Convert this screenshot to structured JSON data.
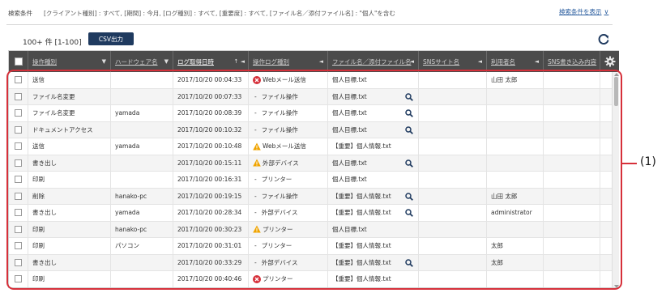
{
  "filter": {
    "label": "検索条件",
    "text": "[クライアント種別] : すべて, [期間] : 今月, [ログ種別] : すべて, [重要度] : すべて, [ファイル名／添付ファイル名] : \"個人\"を含む",
    "toggle_label": "検索条件を表示"
  },
  "results": {
    "count": "100+ 件 [1-100]",
    "csv_label": "CSV出力"
  },
  "columns": [
    "操作種別",
    "ハードウェア名",
    "ログ取得日時",
    "操作ログ種別",
    "ファイル名／添付ファイル名",
    "SNSサイト名",
    "利用者名",
    "SNS書き込み内容"
  ],
  "rows": [
    {
      "op": "送信",
      "hw": "",
      "dt": "2017/10/20 00:04:33",
      "icon": "error",
      "log": "Webメール送信",
      "file": "個人目標.txt",
      "mag": false,
      "user": "山田 太郎"
    },
    {
      "op": "ファイル名変更",
      "hw": "",
      "dt": "2017/10/20 00:07:33",
      "icon": "dash",
      "log": "ファイル操作",
      "file": "個人目標.txt",
      "mag": true,
      "user": ""
    },
    {
      "op": "ファイル名変更",
      "hw": "yamada",
      "dt": "2017/10/20 00:08:39",
      "icon": "dash",
      "log": "ファイル操作",
      "file": "個人目標.txt",
      "mag": true,
      "user": ""
    },
    {
      "op": "ドキュメントアクセス",
      "hw": "",
      "dt": "2017/10/20 00:10:32",
      "icon": "dash",
      "log": "ファイル操作",
      "file": "個人目標.txt",
      "mag": true,
      "user": ""
    },
    {
      "op": "送信",
      "hw": "yamada",
      "dt": "2017/10/20 00:10:48",
      "icon": "warn",
      "log": "Webメール送信",
      "file": "【重要】個人情報.txt",
      "mag": false,
      "user": ""
    },
    {
      "op": "書き出し",
      "hw": "",
      "dt": "2017/10/20 00:15:11",
      "icon": "warn",
      "log": "外部デバイス",
      "file": "個人目標.txt",
      "mag": true,
      "user": ""
    },
    {
      "op": "印刷",
      "hw": "",
      "dt": "2017/10/20 00:16:31",
      "icon": "dash",
      "log": "プリンター",
      "file": "個人目標.txt",
      "mag": false,
      "user": ""
    },
    {
      "op": "削除",
      "hw": "hanako-pc",
      "dt": "2017/10/20 00:19:15",
      "icon": "dash",
      "log": "ファイル操作",
      "file": "【重要】個人情報.txt",
      "mag": true,
      "user": "山田 太郎"
    },
    {
      "op": "書き出し",
      "hw": "yamada",
      "dt": "2017/10/20 00:28:34",
      "icon": "dash",
      "log": "外部デバイス",
      "file": "【重要】個人情報.txt",
      "mag": true,
      "user": "administrator"
    },
    {
      "op": "印刷",
      "hw": "hanako-pc",
      "dt": "2017/10/20 00:30:23",
      "icon": "warn",
      "log": "プリンター",
      "file": "個人目標.txt",
      "mag": false,
      "user": ""
    },
    {
      "op": "印刷",
      "hw": "パソコン",
      "dt": "2017/10/20 00:31:01",
      "icon": "dash",
      "log": "プリンター",
      "file": "【重要】個人情報.txt",
      "mag": false,
      "user": "太郎"
    },
    {
      "op": "書き出し",
      "hw": "",
      "dt": "2017/10/20 00:33:29",
      "icon": "dash",
      "log": "外部デバイス",
      "file": "【重要】個人情報.txt",
      "mag": true,
      "user": "太郎"
    },
    {
      "op": "印刷",
      "hw": "",
      "dt": "2017/10/20 00:40:46",
      "icon": "error",
      "log": "プリンター",
      "file": "【重要】個人情報.txt",
      "mag": false,
      "user": ""
    }
  ],
  "callout": "(1)",
  "colors": {
    "header_bg": "#4b4b4b",
    "accent": "#1f3a5f",
    "error": "#d6303a",
    "warning": "#f0a400",
    "link": "#2a5d9f"
  },
  "icons": {
    "refresh": "refresh-icon",
    "settings": "gear-icon",
    "search": "magnifier-icon",
    "pin": "pin-icon"
  }
}
